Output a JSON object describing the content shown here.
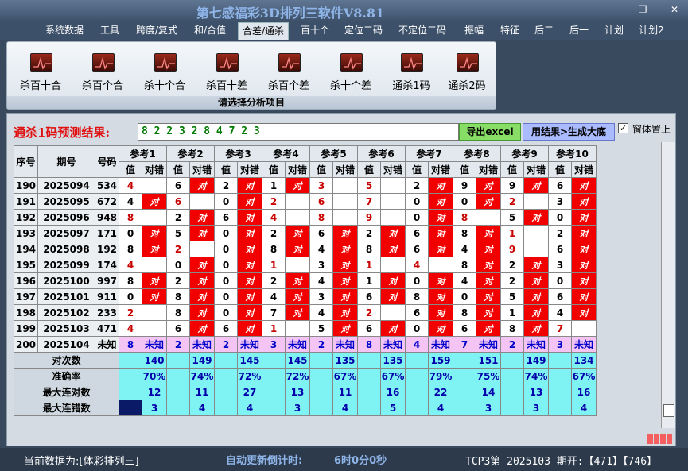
{
  "window": {
    "title": "第七感福彩3D排列三软件V8.81",
    "min_label": "—",
    "max_label": "❐",
    "close_label": "✕"
  },
  "menu": [
    "系统数据",
    "工具",
    "跨度/复式",
    "和/合值",
    "合差/通杀",
    "百十个",
    "定位二码",
    "不定位二码",
    "振幅",
    "特征",
    "后二",
    "后一",
    "计划",
    "计划2"
  ],
  "menu_active": "合差/通杀",
  "ribbon": {
    "buttons": [
      "杀百十合",
      "杀百个合",
      "杀十个合",
      "杀百十差",
      "杀百个差",
      "杀十个差",
      "通杀1码",
      "通杀2码"
    ],
    "caption": "请选择分析项目"
  },
  "prediction": {
    "label": "通杀1码预测结果:",
    "value": "8 2 2 3 2 8 4 7 2 3",
    "export_label": "导出excel",
    "generate_label": "用结果>生成大底",
    "topmost_label": "窗体置上",
    "topmost_checked": "✓"
  },
  "table": {
    "headers": {
      "seq": "序号",
      "period": "期号",
      "number": "号码"
    },
    "ref_headers": [
      "参考1",
      "参考2",
      "参考3",
      "参考4",
      "参考5",
      "参考6",
      "参考7",
      "参考8",
      "参考9",
      "参考10"
    ],
    "sub_value": "值",
    "sub_result": "对错",
    "hit_text": "对",
    "rows": [
      {
        "seq": "190",
        "period": "2025094",
        "num": "534",
        "vals": [
          "4",
          "6",
          "2",
          "1",
          "3",
          "5",
          "2",
          "9",
          "9",
          "6"
        ],
        "hits": [
          false,
          true,
          true,
          true,
          false,
          false,
          true,
          true,
          true,
          true
        ]
      },
      {
        "seq": "191",
        "period": "2025095",
        "num": "672",
        "vals": [
          "4",
          "6",
          "0",
          "2",
          "6",
          "7",
          "0",
          "0",
          "2",
          "3"
        ],
        "hits": [
          true,
          false,
          true,
          false,
          false,
          false,
          true,
          true,
          false,
          true
        ]
      },
      {
        "seq": "192",
        "period": "2025096",
        "num": "948",
        "vals": [
          "8",
          "2",
          "6",
          "4",
          "8",
          "9",
          "0",
          "8",
          "5",
          "0"
        ],
        "hits": [
          false,
          true,
          true,
          false,
          false,
          false,
          true,
          false,
          true,
          true
        ]
      },
      {
        "seq": "193",
        "period": "2025097",
        "num": "171",
        "vals": [
          "0",
          "5",
          "0",
          "2",
          "6",
          "2",
          "6",
          "8",
          "1",
          "2"
        ],
        "hits": [
          true,
          true,
          true,
          true,
          true,
          true,
          true,
          true,
          false,
          true
        ]
      },
      {
        "seq": "194",
        "period": "2025098",
        "num": "192",
        "vals": [
          "8",
          "2",
          "0",
          "8",
          "4",
          "8",
          "6",
          "4",
          "9",
          "6"
        ],
        "hits": [
          true,
          false,
          true,
          true,
          true,
          true,
          true,
          true,
          false,
          true
        ]
      },
      {
        "seq": "195",
        "period": "2025099",
        "num": "174",
        "vals": [
          "4",
          "0",
          "0",
          "1",
          "3",
          "1",
          "4",
          "8",
          "2",
          "3"
        ],
        "hits": [
          false,
          true,
          true,
          false,
          true,
          false,
          false,
          true,
          true,
          true
        ]
      },
      {
        "seq": "196",
        "period": "2025100",
        "num": "997",
        "vals": [
          "8",
          "2",
          "0",
          "2",
          "4",
          "1",
          "0",
          "4",
          "2",
          "0"
        ],
        "hits": [
          true,
          true,
          true,
          true,
          true,
          true,
          true,
          true,
          true,
          true
        ]
      },
      {
        "seq": "197",
        "period": "2025101",
        "num": "911",
        "vals": [
          "0",
          "8",
          "0",
          "4",
          "3",
          "6",
          "8",
          "0",
          "5",
          "6"
        ],
        "hits": [
          true,
          true,
          true,
          true,
          true,
          true,
          true,
          true,
          true,
          true
        ]
      },
      {
        "seq": "198",
        "period": "2025102",
        "num": "233",
        "vals": [
          "2",
          "8",
          "0",
          "7",
          "4",
          "2",
          "6",
          "8",
          "1",
          "4"
        ],
        "hits": [
          false,
          true,
          true,
          true,
          true,
          false,
          true,
          true,
          true,
          true
        ]
      },
      {
        "seq": "199",
        "period": "2025103",
        "num": "471",
        "vals": [
          "4",
          "6",
          "6",
          "1",
          "5",
          "6",
          "0",
          "6",
          "8",
          "7"
        ],
        "hits": [
          false,
          true,
          true,
          false,
          true,
          true,
          true,
          true,
          true,
          false
        ]
      }
    ],
    "future_row": {
      "seq": "200",
      "period": "2025104",
      "num": "未知",
      "vals": [
        "8",
        "2",
        "2",
        "3",
        "2",
        "8",
        "4",
        "7",
        "2",
        "3"
      ],
      "result": "未知"
    },
    "stats": [
      {
        "label": "对次数",
        "values": [
          "140",
          "149",
          "145",
          "145",
          "135",
          "135",
          "159",
          "151",
          "149",
          "134"
        ]
      },
      {
        "label": "准确率",
        "values": [
          "70%",
          "74%",
          "72%",
          "72%",
          "67%",
          "67%",
          "79%",
          "75%",
          "74%",
          "67%"
        ]
      },
      {
        "label": "最大连对数",
        "values": [
          "12",
          "11",
          "27",
          "13",
          "11",
          "16",
          "22",
          "14",
          "13",
          "16"
        ]
      },
      {
        "label": "最大连错数",
        "values": [
          "3",
          "4",
          "4",
          "3",
          "4",
          "5",
          "4",
          "3",
          "3",
          "4"
        ]
      }
    ]
  },
  "status": {
    "source": "当前数据为:[体彩排列三]",
    "countdown_label": "自动更新倒计时:",
    "countdown": "6时0分0秒",
    "draw": "TCP3第 2025103 期开:【471】【746】"
  }
}
